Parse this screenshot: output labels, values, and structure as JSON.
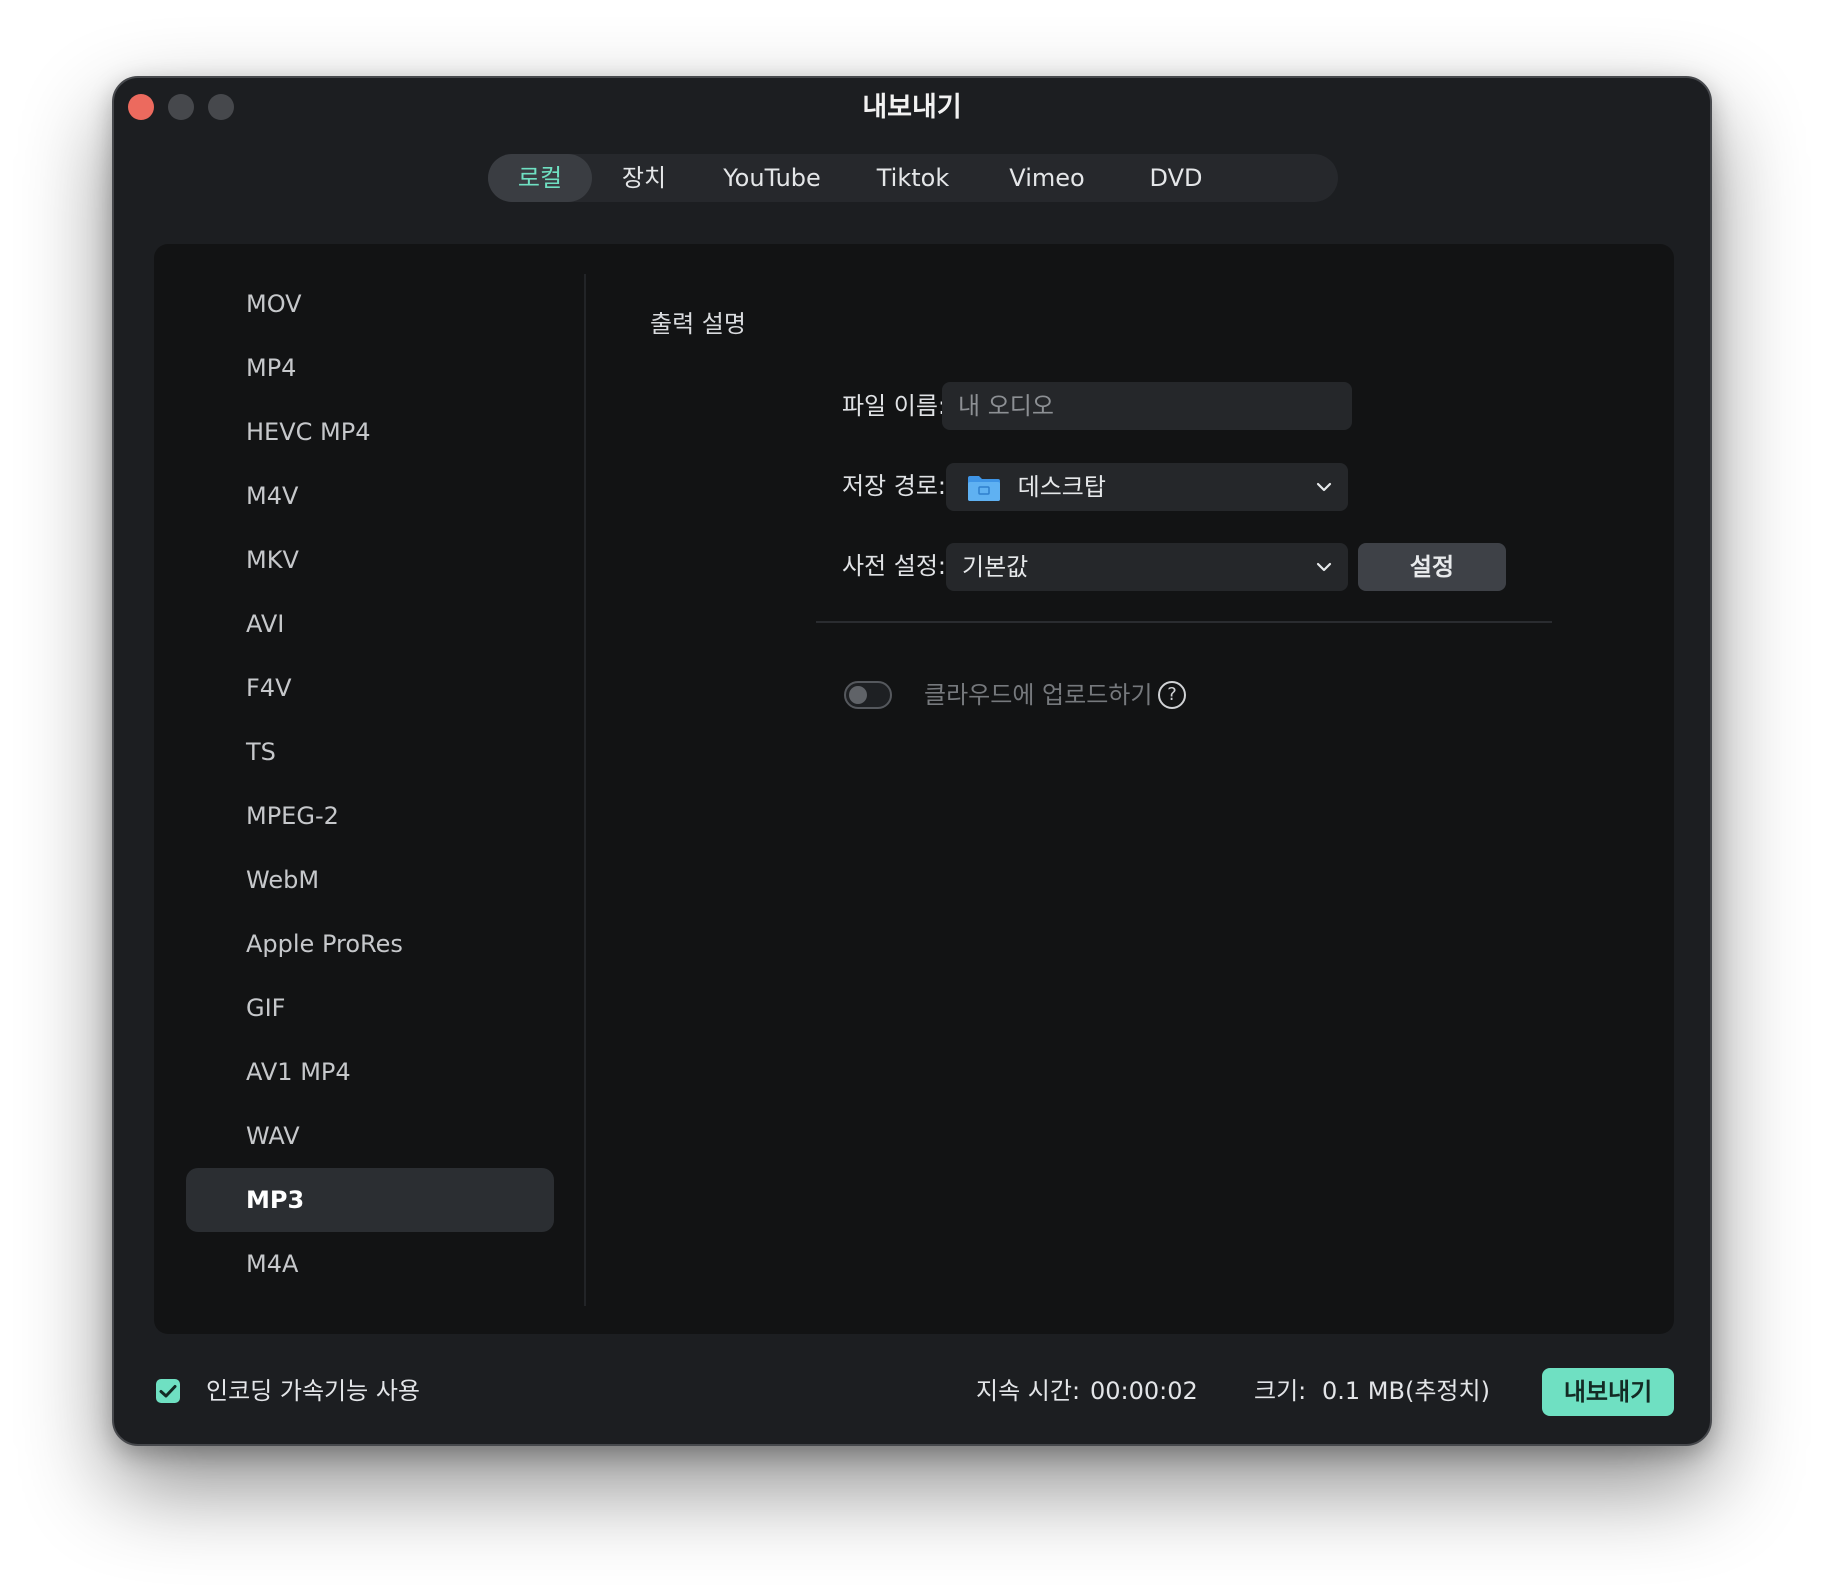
{
  "window": {
    "title": "내보내기"
  },
  "tabs": [
    {
      "label": "로컬",
      "active": true
    },
    {
      "label": "장치",
      "active": false
    },
    {
      "label": "YouTube",
      "active": false
    },
    {
      "label": "Tiktok",
      "active": false
    },
    {
      "label": "Vimeo",
      "active": false
    },
    {
      "label": "DVD",
      "active": false
    }
  ],
  "formats": [
    "MOV",
    "MP4",
    "HEVC MP4",
    "M4V",
    "MKV",
    "AVI",
    "F4V",
    "TS",
    "MPEG-2",
    "WebM",
    "Apple ProRes",
    "GIF",
    "AV1 MP4",
    "WAV",
    "MP3",
    "M4A"
  ],
  "selected_format": "MP3",
  "settings": {
    "section_title": "출력 설명",
    "filename_label": "파일 이름:",
    "filename_value": "내 오디오",
    "path_label": "저장 경로:",
    "path_value": "데스크탑",
    "preset_label": "사전 설정:",
    "preset_value": "기본값",
    "settings_button": "설정",
    "cloud_label": "클라우드에 업로드하기",
    "cloud_enabled": false,
    "help_glyph": "?"
  },
  "footer": {
    "gpu_label": "인코딩 가속기능 사용",
    "gpu_checked": true,
    "duration_label": "지속 시간:",
    "duration_value": "00:00:02",
    "size_label": "크기:",
    "size_value": "0.1 MB(추정치)",
    "export_button": "내보내기"
  },
  "colors": {
    "accent": "#6fe0c2",
    "window_bg": "#1c1e21",
    "panel_bg": "#121314",
    "close": "#ec6a5e",
    "inactive_light": "#46484c"
  },
  "icons": {
    "folder": "folder-icon",
    "chevron": "chevron-down-icon",
    "help": "help-icon",
    "check": "checkmark-icon"
  }
}
